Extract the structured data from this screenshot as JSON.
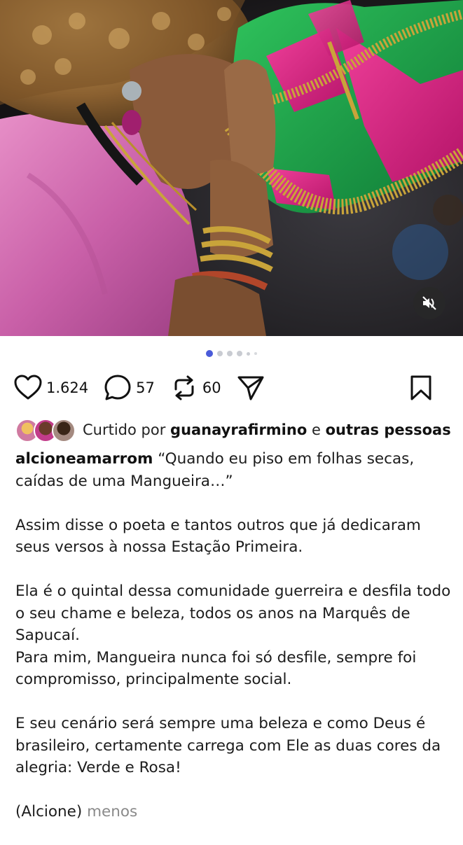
{
  "post": {
    "image_alt": "",
    "carousel": {
      "count": 6,
      "active_index": 0
    },
    "actions": {
      "likes": "1.624",
      "comments": "57",
      "reposts": "60"
    },
    "liked_by": {
      "prefix": "Curtido por",
      "user": "guanayrafirmino",
      "connector": "e",
      "others": "outras pessoas"
    },
    "caption": {
      "username": "alcioneamarrom",
      "para1": "“Quando eu piso em folhas secas, caídas de uma Mangueira…”",
      "para2": "Assim disse o poeta e tantos outros que já dedicaram seus versos à nossa Estação Primeira.",
      "para3a": "Ela é o quintal dessa comunidade guerreira e desfila todo o seu chame e beleza, todos os anos na Marquês de Sapucaí.",
      "para3b": "Para mim, Mangueira nunca foi só desfile, sempre foi compromisso, principalmente social.",
      "para4": "E seu cenário será sempre uma beleza e como Deus é brasileiro, certamente carrega com Ele as duas cores da alegria: Verde e Rosa!",
      "signature": "(Alcione)",
      "less_label": "menos"
    }
  },
  "icons": {
    "like": "heart-icon",
    "comment": "comment-bubble-icon",
    "repost": "repost-icon",
    "share": "send-icon",
    "save": "bookmark-icon",
    "mute": "speaker-muted-icon"
  },
  "colors": {
    "accent_dot": "#4a5bd9",
    "flag_green": "#1f9a4a",
    "flag_pink": "#d8257f",
    "fringe_gold": "#c9a43a"
  }
}
